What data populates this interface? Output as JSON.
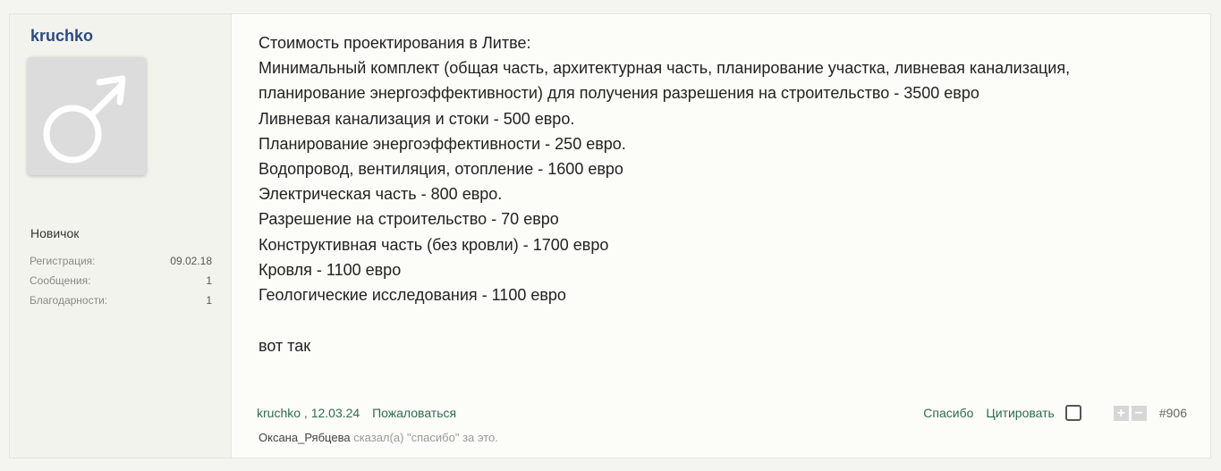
{
  "author": {
    "username": "kruchko",
    "avatar_icon": "male-symbol-icon",
    "rank": "Новичок",
    "stats": [
      {
        "label": "Регистрация:",
        "value": "09.02.18"
      },
      {
        "label": "Сообщения:",
        "value": "1"
      },
      {
        "label": "Благодарности:",
        "value": "1"
      }
    ]
  },
  "post": {
    "lines": [
      "Стоимость проектирования в Литве:",
      "Минимальный комплект (общая часть, архитектурная часть, планирование участка, ливневая канализация,",
      "планирование энергоэффективности) для получения разрешения на строительство - 3500 евро",
      "Ливневая канализация и стоки - 500 евро.",
      "Планирование энергоэффективности - 250 евро.",
      "Водопровод, вентиляция, отопление - 1600 евро",
      "Электрическая часть - 800 евро.",
      "Разрешение на строительство - 70 евро",
      "Конструктивная часть (без кровли) - 1700 евро",
      "Кровля - 1100 евро",
      "Геологические исследования - 1100 евро"
    ],
    "closing": "вот так"
  },
  "footer": {
    "author": "kruchko",
    "separator": ",",
    "date": "12.03.24",
    "report": "Пожаловаться",
    "thanks_button": "Спасибо",
    "quote_button": "Цитировать",
    "plus": "+",
    "minus": "−",
    "post_number": "#906",
    "thanked_user": "Оксана_Рябцева",
    "thanked_text": "сказал(а) \"спасибо\" за это."
  },
  "colors": {
    "username": "#2a4b86",
    "link": "#2e6b4f",
    "background": "#f4f4f1"
  }
}
